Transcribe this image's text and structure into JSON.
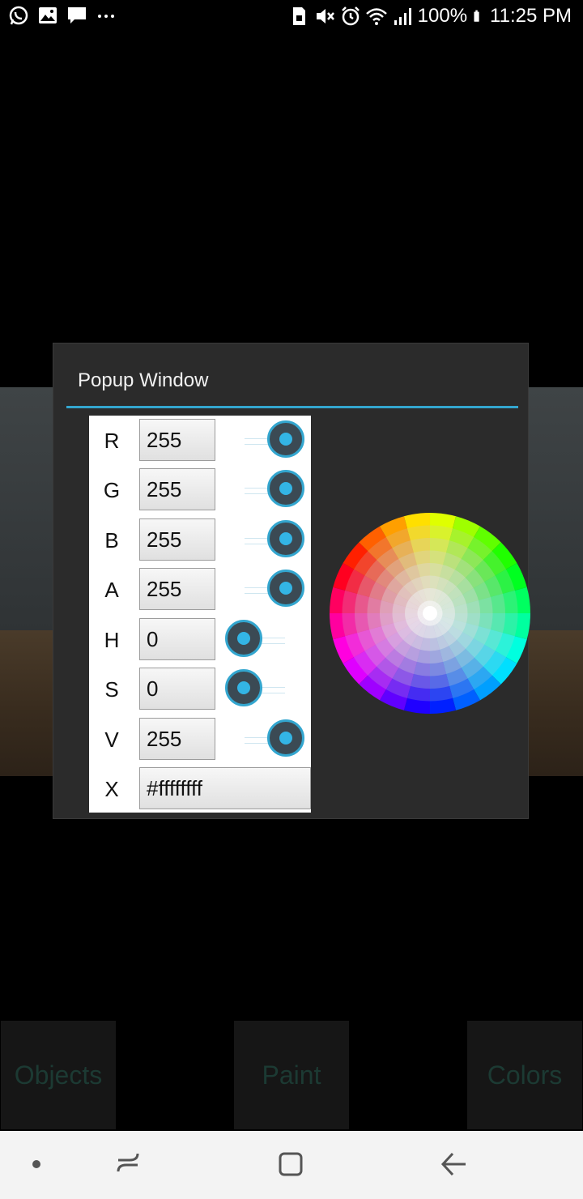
{
  "status_bar": {
    "left_icons": [
      "whatsapp-icon",
      "image-icon",
      "chat-icon",
      "more-dots-icon"
    ],
    "right_icons": [
      "sim-icon",
      "mute-icon",
      "alarm-icon",
      "wifi-icon",
      "signal-icon",
      "battery-icon"
    ],
    "battery": "100%",
    "time": "11:25 PM"
  },
  "popup": {
    "title": "Popup Window",
    "rows": [
      {
        "label": "R",
        "value": "255",
        "slider_level": 1.0
      },
      {
        "label": "G",
        "value": "255",
        "slider_level": 1.0
      },
      {
        "label": "B",
        "value": "255",
        "slider_level": 1.0
      },
      {
        "label": "A",
        "value": "255",
        "slider_level": 1.0
      },
      {
        "label": "H",
        "value": "0",
        "slider_level": 0.0
      },
      {
        "label": "S",
        "value": "0",
        "slider_level": 0.0
      },
      {
        "label": "V",
        "value": "255",
        "slider_level": 1.0
      },
      {
        "label": "X",
        "value": "#ffffffff"
      }
    ],
    "accent_color": "#33a6cf"
  },
  "bottom_buttons": {
    "objects": "Objects",
    "paint": "Paint",
    "colors": "Colors"
  },
  "nav_bar": {
    "icons": [
      "dot-icon",
      "recents-icon",
      "home-icon",
      "back-icon"
    ]
  }
}
